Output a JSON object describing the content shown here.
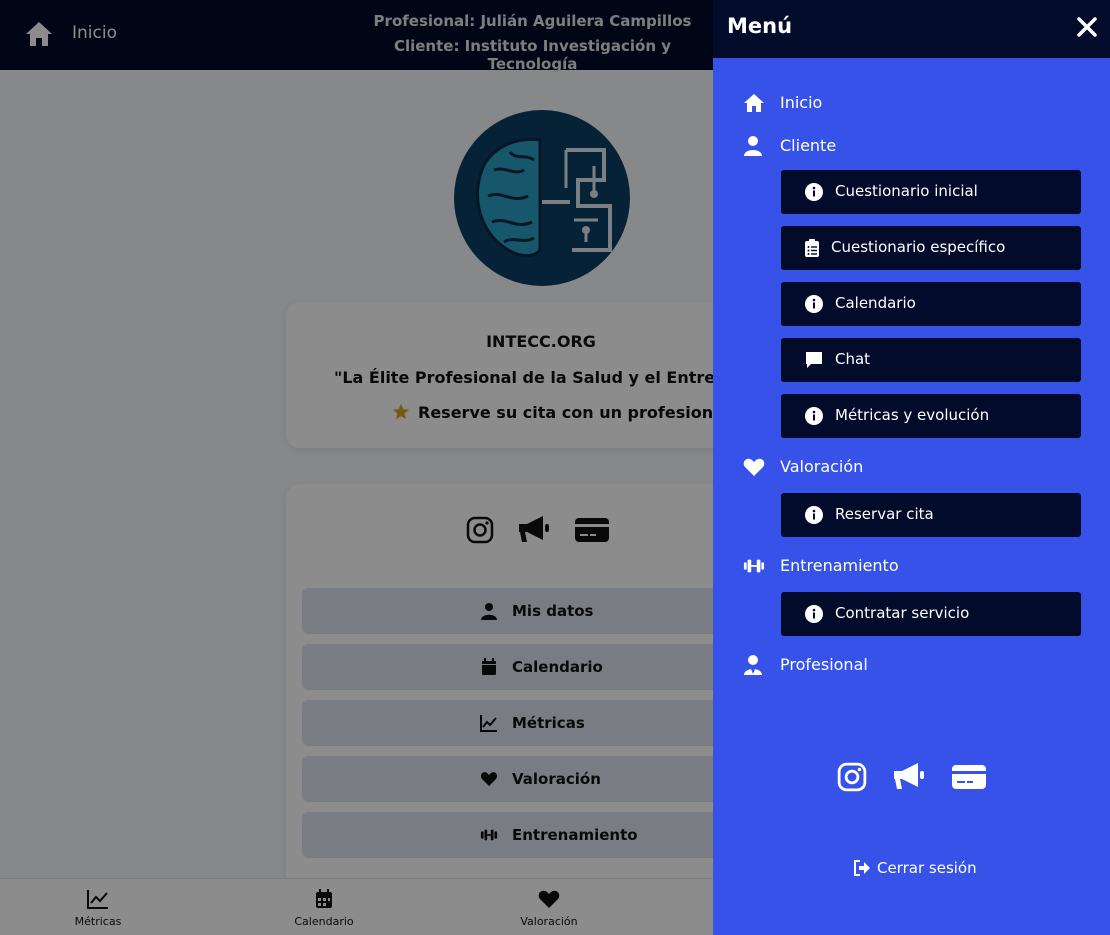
{
  "topbar": {
    "home_label": "Inicio",
    "profesional": "Profesional: Julián Aguilera Campillos",
    "cliente": "Cliente: Instituto Investigación y Tecnología"
  },
  "info_card": {
    "org": "INTECC.ORG",
    "slogan": "\"La Élite Profesional de la Salud y el Entrenamiento\"",
    "reserve": "Reserve su cita con un profesional"
  },
  "page_menu": {
    "items": [
      {
        "label": "Mis datos",
        "icon": "user-icon"
      },
      {
        "label": "Calendario",
        "icon": "calendar-icon"
      },
      {
        "label": "Métricas",
        "icon": "chart-line-icon"
      },
      {
        "label": "Valoración",
        "icon": "heart-icon"
      },
      {
        "label": "Entrenamiento",
        "icon": "dumbbell-icon"
      }
    ]
  },
  "bottom_nav": {
    "items": [
      {
        "label": "Métricas",
        "icon": "chart-line-icon"
      },
      {
        "label": "Calendario",
        "icon": "calendar-icon"
      },
      {
        "label": "Valoración",
        "icon": "heart-icon"
      }
    ]
  },
  "drawer": {
    "title": "Menú",
    "sections": {
      "inicio": "Inicio",
      "cliente": "Cliente",
      "valoracion": "Valoración",
      "entrenamiento": "Entrenamiento",
      "profesional": "Profesional"
    },
    "cliente_items": [
      {
        "label": "Cuestionario inicial",
        "icon": "info-icon"
      },
      {
        "label": "Cuestionario específico",
        "icon": "clipboard-list-icon"
      },
      {
        "label": "Calendario",
        "icon": "info-icon"
      },
      {
        "label": "Chat",
        "icon": "chat-icon"
      },
      {
        "label": "Métricas y evolución",
        "icon": "info-icon"
      }
    ],
    "valoracion_items": [
      {
        "label": "Reservar cita",
        "icon": "info-icon"
      }
    ],
    "entrenamiento_items": [
      {
        "label": "Contratar servicio",
        "icon": "info-icon"
      }
    ],
    "logout": "Cerrar sesión"
  },
  "colors": {
    "topbar": "#030b2b",
    "drawer": "#3652e8",
    "drawer_button": "#030b2b",
    "page_button": "#dde4ef"
  }
}
